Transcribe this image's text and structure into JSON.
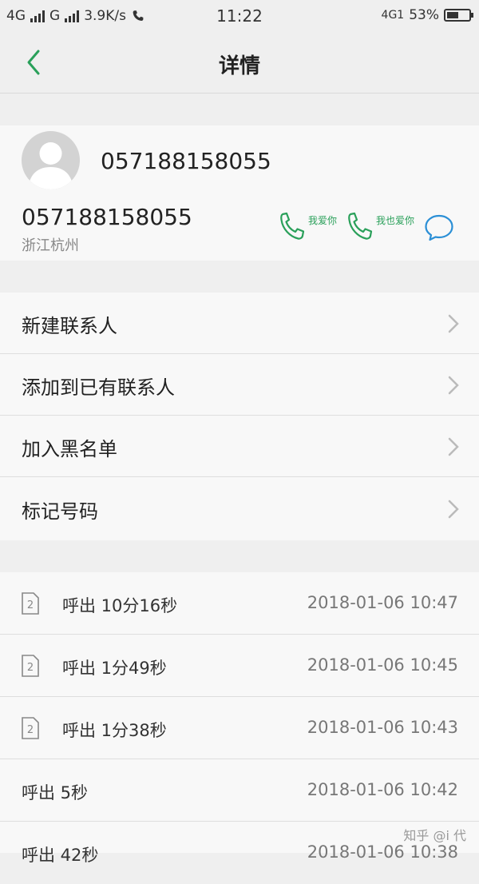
{
  "status_bar": {
    "network1": "4G",
    "network2": "G",
    "speed": "3.9K/s",
    "call_icon": "phone-call-icon",
    "time": "11:22",
    "network3": "4G1",
    "battery": "53%",
    "battery_level": 0.53
  },
  "header": {
    "back_icon": "chevron-left-icon",
    "title": "详情"
  },
  "contact": {
    "avatar_icon": "avatar-placeholder-icon",
    "name": "057188158055",
    "phone": "057188158055",
    "location": "浙江杭州",
    "call_sim1_label": "我爱你",
    "call_sim2_label": "我也爱你",
    "accent_color": "#2aa05a",
    "message_color": "#2b8fd6"
  },
  "menu": {
    "items": [
      {
        "label": "新建联系人"
      },
      {
        "label": "添加到已有联系人"
      },
      {
        "label": "加入黑名单"
      },
      {
        "label": "标记号码"
      }
    ]
  },
  "history": {
    "rows": [
      {
        "sim": "2",
        "label": "呼出 10分16秒",
        "time": "2018-01-06 10:47"
      },
      {
        "sim": "2",
        "label": "呼出 1分49秒",
        "time": "2018-01-06 10:45"
      },
      {
        "sim": "2",
        "label": "呼出 1分38秒",
        "time": "2018-01-06 10:43"
      },
      {
        "sim": "",
        "label": "呼出 5秒",
        "time": "2018-01-06 10:42"
      },
      {
        "sim": "",
        "label": "呼出 42秒",
        "time": "2018-01-06 10:38"
      }
    ]
  },
  "watermark": "知乎 @i 代"
}
